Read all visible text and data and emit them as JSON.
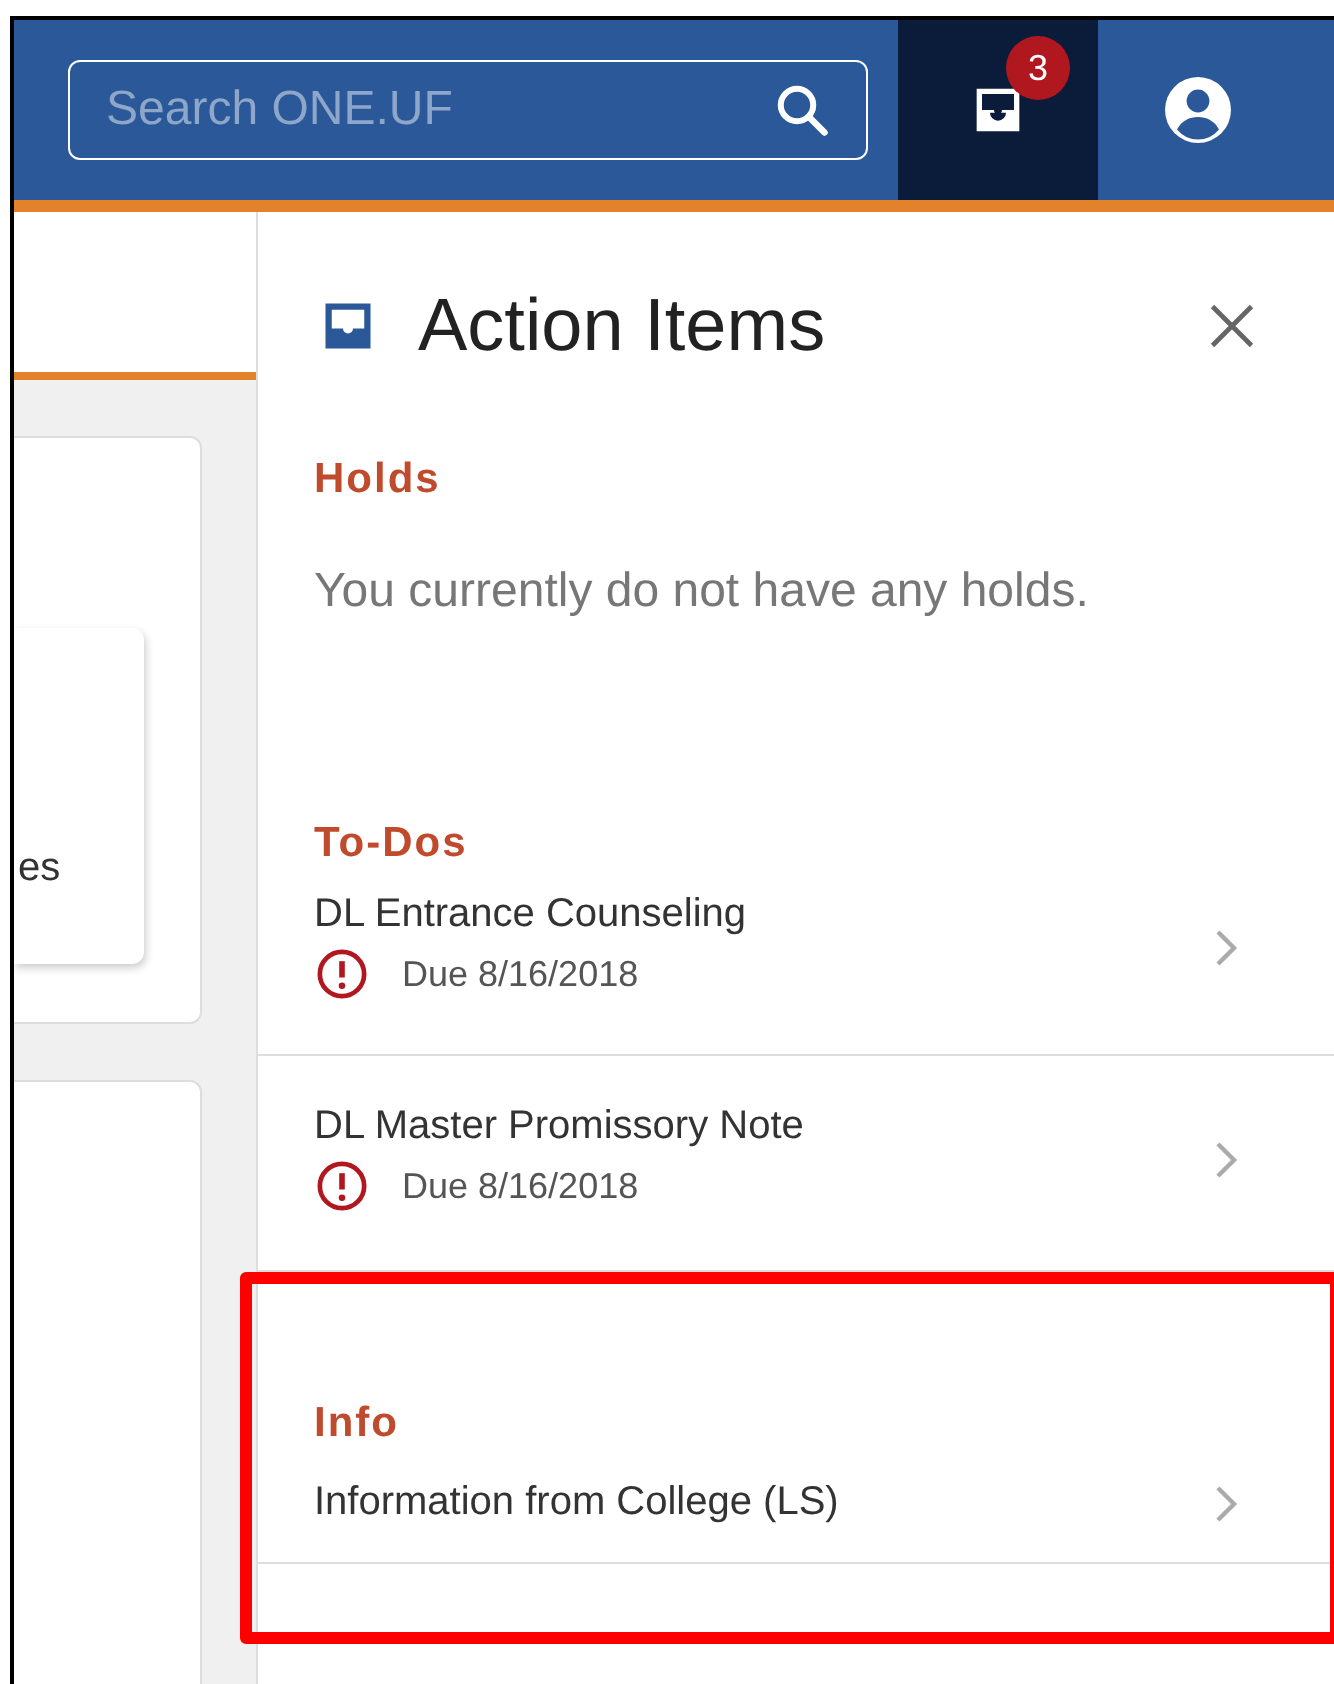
{
  "header": {
    "search": {
      "placeholder": "Search ONE.UF"
    },
    "notifications": {
      "badge": "3",
      "selected": true
    }
  },
  "background": {
    "card_text": "es"
  },
  "panel": {
    "title": "Action Items",
    "sections": [
      {
        "heading": "Holds",
        "kind": "message",
        "text": "You currently do not have any holds.",
        "highlighted": false
      },
      {
        "heading": "To-Dos",
        "kind": "items",
        "highlighted": false,
        "items": [
          {
            "title": "DL Entrance Counseling",
            "due": "Due 8/16/2018"
          },
          {
            "title": "DL Master Promissory Note",
            "due": "Due 8/16/2018"
          }
        ]
      },
      {
        "heading": "Info",
        "kind": "items",
        "highlighted": true,
        "items": [
          {
            "title": "Information from College (LS)"
          }
        ]
      }
    ]
  }
}
